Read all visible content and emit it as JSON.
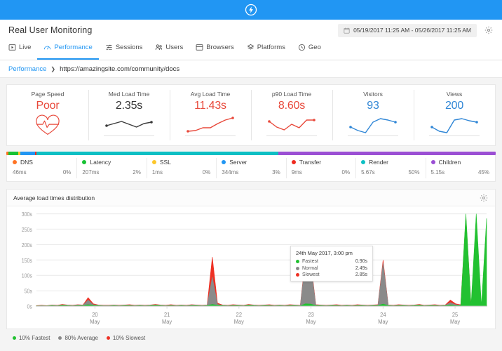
{
  "brand": {
    "logo_icon": "lightning-bolt-icon",
    "bar_color": "#2196f3"
  },
  "header": {
    "title": "Real User Monitoring",
    "date_range": "05/19/2017 11:25 AM - 05/26/2017 11:25 AM",
    "calendar_icon": "calendar-icon",
    "settings_icon": "gear-icon"
  },
  "tabs": [
    {
      "label": "Live",
      "icon": "play-box-icon",
      "active": false
    },
    {
      "label": "Performance",
      "icon": "gauge-icon",
      "active": true
    },
    {
      "label": "Sessions",
      "icon": "sliders-icon",
      "active": false
    },
    {
      "label": "Users",
      "icon": "users-icon",
      "active": false
    },
    {
      "label": "Browsers",
      "icon": "window-icon",
      "active": false
    },
    {
      "label": "Platforms",
      "icon": "layers-icon",
      "active": false
    },
    {
      "label": "Geo",
      "icon": "globe-clock-icon",
      "active": false
    }
  ],
  "breadcrumb": {
    "parent": "Performance",
    "separator": "❯",
    "current": "https://amazingsite.com/community/docs"
  },
  "metrics": [
    {
      "label": "Page Speed",
      "value": "Poor",
      "value_color": "#e8483a",
      "visual": "heart-pulse-icon"
    },
    {
      "label": "Med Load Time",
      "value": "2.35s",
      "value_color": "#333333",
      "visual": "sparkline",
      "spark_color": "#3a3a3a",
      "spark_points": [
        14,
        11,
        8,
        12,
        16,
        11,
        9
      ]
    },
    {
      "label": "Avg Load Time",
      "value": "11.43s",
      "value_color": "#e8483a",
      "visual": "sparkline",
      "spark_color": "#e8483a",
      "spark_points": [
        22,
        21,
        17,
        17,
        11,
        6,
        3
      ]
    },
    {
      "label": "p90 Load Time",
      "value": "8.60s",
      "value_color": "#e8483a",
      "visual": "sparkline",
      "spark_color": "#e8483a",
      "spark_points": [
        8,
        16,
        20,
        12,
        17,
        6,
        6
      ]
    },
    {
      "label": "Visitors",
      "value": "93",
      "value_color": "#2f86d6",
      "visual": "sparkline",
      "spark_color": "#2f86d6",
      "spark_points": [
        16,
        21,
        24,
        9,
        4,
        6,
        9
      ]
    },
    {
      "label": "Views",
      "value": "200",
      "value_color": "#2f86d6",
      "visual": "sparkline",
      "spark_color": "#2f86d6",
      "spark_points": [
        16,
        22,
        24,
        6,
        4,
        7,
        9
      ]
    }
  ],
  "breakdown": {
    "items": [
      {
        "name": "DNS",
        "time": "46ms",
        "pct": "0%",
        "pct_num": 0.5,
        "color": "#ff7424"
      },
      {
        "name": "Latency",
        "time": "207ms",
        "pct": "2%",
        "pct_num": 2,
        "color": "#17c233"
      },
      {
        "name": "SSL",
        "time": "1ms",
        "pct": "0%",
        "pct_num": 0.4,
        "color": "#fdc72b"
      },
      {
        "name": "Server",
        "time": "344ms",
        "pct": "3%",
        "pct_num": 3,
        "color": "#2196f3"
      },
      {
        "name": "Transfer",
        "time": "9ms",
        "pct": "0%",
        "pct_num": 0.4,
        "color": "#ef2b1f"
      },
      {
        "name": "Render",
        "time": "5.67s",
        "pct": "50%",
        "pct_num": 50,
        "color": "#0dbfc4"
      },
      {
        "name": "Children",
        "time": "5.15s",
        "pct": "45%",
        "pct_num": 45,
        "color": "#9b4fd4"
      }
    ]
  },
  "chart_panel": {
    "title": "Average load times distribution",
    "settings_icon": "gear-icon"
  },
  "tooltip": {
    "title": "24th May 2017, 3:00 pm",
    "rows": [
      {
        "name": "Fastest",
        "value": "0.90s",
        "color": "#22c131"
      },
      {
        "name": "Normal",
        "value": "2.49s",
        "color": "#8a8a8a"
      },
      {
        "name": "Slowest",
        "value": "2.85s",
        "color": "#ee3124"
      }
    ]
  },
  "legend": [
    {
      "label": "10% Fastest",
      "color": "#22c131"
    },
    {
      "label": "80% Average",
      "color": "#8a8a8a"
    },
    {
      "label": "10% Slowest",
      "color": "#ee3124"
    }
  ],
  "chart_data": {
    "type": "area",
    "title": "Average load times distribution",
    "xlabel": "",
    "ylabel": "",
    "ylim": [
      0,
      300
    ],
    "yticks": [
      "0s",
      "50s",
      "100s",
      "150s",
      "200s",
      "250s",
      "300s"
    ],
    "ytick_values": [
      0,
      50,
      100,
      150,
      200,
      250,
      300
    ],
    "grid": true,
    "legend_position": "bottom-left",
    "xtick_labels": [
      "20\nMay",
      "21\nMay",
      "22\nMay",
      "23\nMay",
      "24\nMay",
      "25\nMay"
    ],
    "xtick_positions": [
      0.13,
      0.29,
      0.45,
      0.61,
      0.77,
      0.93
    ],
    "series": [
      {
        "name": "10% Slowest",
        "color": "#ee3124",
        "values": [
          2,
          3,
          2,
          4,
          3,
          6,
          4,
          3,
          5,
          4,
          28,
          8,
          4,
          3,
          3,
          4,
          3,
          4,
          5,
          3,
          4,
          3,
          4,
          6,
          4,
          3,
          5,
          3,
          4,
          3,
          5,
          4,
          3,
          4,
          160,
          10,
          4,
          3,
          5,
          4,
          3,
          6,
          4,
          3,
          4,
          5,
          3,
          4,
          3,
          5,
          4,
          3,
          160,
          150,
          5,
          4,
          3,
          4,
          5,
          3,
          4,
          3,
          5,
          4,
          3,
          4,
          5,
          150,
          4,
          3,
          5,
          4,
          3,
          4,
          6,
          3,
          4,
          5,
          3,
          4,
          20,
          8,
          5,
          290,
          4,
          3,
          4,
          3
        ]
      },
      {
        "name": "80% Average",
        "color": "#8a8a8a",
        "values": [
          1,
          2,
          1,
          3,
          2,
          4,
          3,
          2,
          4,
          3,
          20,
          5,
          3,
          2,
          2,
          3,
          2,
          3,
          3,
          2,
          3,
          2,
          3,
          4,
          3,
          2,
          3,
          2,
          3,
          2,
          4,
          3,
          2,
          3,
          95,
          6,
          3,
          2,
          3,
          3,
          2,
          4,
          3,
          2,
          3,
          3,
          2,
          3,
          2,
          3,
          3,
          2,
          150,
          140,
          3,
          3,
          2,
          3,
          3,
          2,
          3,
          2,
          3,
          3,
          2,
          3,
          3,
          140,
          3,
          2,
          3,
          3,
          2,
          3,
          4,
          2,
          3,
          3,
          2,
          3,
          12,
          5,
          3,
          5,
          3,
          2,
          3,
          2
        ]
      },
      {
        "name": "10% Fastest",
        "color": "#22c131",
        "values": [
          1,
          1,
          1,
          2,
          1,
          3,
          2,
          1,
          2,
          2,
          5,
          3,
          2,
          1,
          1,
          2,
          1,
          2,
          2,
          1,
          2,
          1,
          2,
          3,
          2,
          1,
          2,
          1,
          2,
          1,
          2,
          2,
          1,
          2,
          6,
          3,
          2,
          1,
          2,
          2,
          1,
          3,
          2,
          1,
          2,
          2,
          1,
          2,
          1,
          2,
          2,
          1,
          8,
          7,
          2,
          2,
          1,
          2,
          2,
          1,
          2,
          1,
          2,
          2,
          1,
          2,
          2,
          7,
          2,
          1,
          2,
          2,
          1,
          2,
          3,
          1,
          2,
          2,
          1,
          2,
          4,
          2,
          2,
          300,
          2,
          300,
          2,
          285
        ]
      }
    ],
    "annotated_point": {
      "label": "24th May 2017, 3:00 pm",
      "fastest": 0.9,
      "normal": 2.49,
      "slowest": 2.85
    }
  }
}
